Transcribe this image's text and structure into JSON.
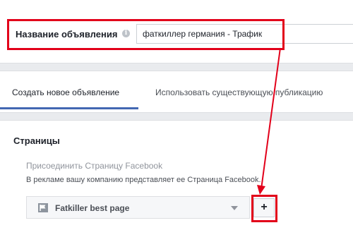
{
  "ad_name": {
    "label": "Название объявления",
    "info_icon": "i",
    "value": "фаткиллер германия - Трафик"
  },
  "tabs": [
    {
      "label": "Создать новое объявление",
      "active": true
    },
    {
      "label": "Использовать существующую публикацию",
      "active": false
    }
  ],
  "pages_section": {
    "title": "Страницы",
    "connect_label": "Присоединить Страницу Facebook",
    "description": "В рекламе вашу компанию представляет ее Страница Facebook.",
    "selected_page": "Fatkiller best page",
    "add_button_label": "+"
  },
  "colors": {
    "highlight": "#e2001a",
    "accent": "#4267b2",
    "background": "#e9ebee"
  },
  "icons": {
    "info": "info-icon",
    "flag": "flag-icon",
    "dropdown": "chevron-down-icon"
  }
}
